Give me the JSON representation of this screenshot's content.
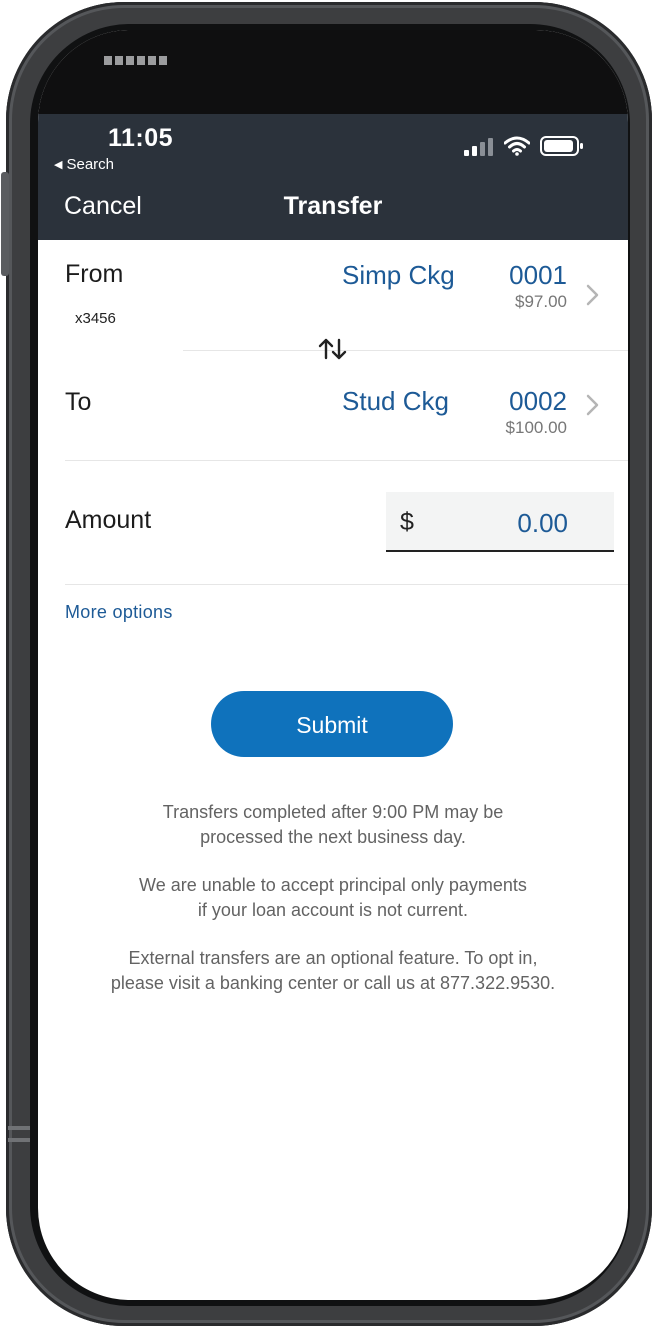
{
  "status_bar": {
    "time": "11:05",
    "back_label": "Search",
    "icons": [
      "cellular-signal-icon",
      "wifi-icon",
      "battery-icon"
    ]
  },
  "nav": {
    "cancel_label": "Cancel",
    "title": "Transfer"
  },
  "transfer": {
    "from": {
      "label": "From",
      "account_name": "Simp Ckg",
      "account_number": "0001",
      "balance": "$97.00",
      "masked_number": "x3456"
    },
    "to": {
      "label": "To",
      "account_name": "Stud Ckg",
      "account_number": "0002",
      "balance": "$100.00"
    },
    "amount": {
      "label": "Amount",
      "currency": "$",
      "value": "0.00"
    },
    "more_options_label": "More options",
    "submit_label": "Submit"
  },
  "disclaimers": {
    "line1a": "Transfers completed after 9:00 PM may be",
    "line1b": "processed the next business day.",
    "line2a": "We are unable to accept principal only payments",
    "line2b": "if your loan account is not current.",
    "line3a": "External transfers are an optional feature. To opt in,",
    "line3b": "please visit a banking center or call us at 877.322.9530."
  },
  "colors": {
    "header_bg": "#2b323b",
    "link_blue": "#1d5a96",
    "submit_blue": "#0f72bc"
  }
}
